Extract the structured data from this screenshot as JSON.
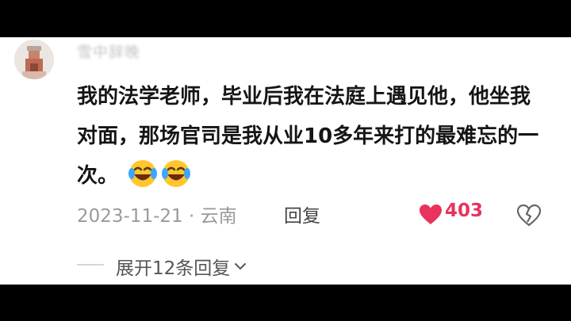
{
  "comment": {
    "username": "雪中辞晚",
    "text": "我的法学老师，毕业后我在法庭上遇见他，他坐我对面，那场官司是我从业10多年来打的最难忘的一次。",
    "emojis": [
      "laughing-tears",
      "laughing-tears"
    ],
    "date": "2023-11-21",
    "separator": "·",
    "location": "云南",
    "reply_label": "回复",
    "like_count": "403",
    "expand_label": "展开12条回复"
  },
  "colors": {
    "like": "#e8335c",
    "text": "#151515",
    "meta": "#9a9a9a",
    "backdrop": "#000000"
  }
}
